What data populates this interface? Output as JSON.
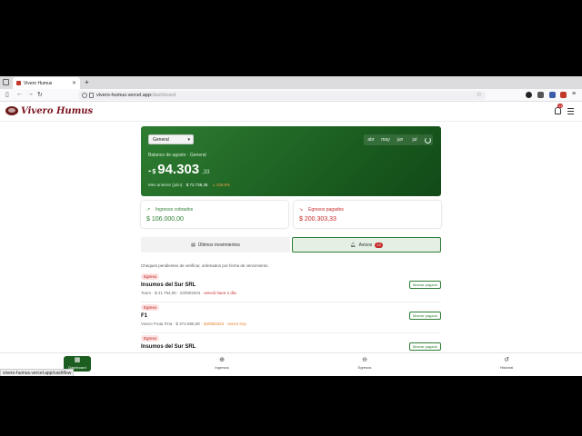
{
  "browser": {
    "tab_title": "Vivero Humus",
    "url_host": "vivero-humus.vercel.app",
    "url_path": "/dashboard",
    "status_url": "vivero-humus.vercel.app/cashflow"
  },
  "header": {
    "brand": "Vivero Humus",
    "notif_count": "13"
  },
  "balance": {
    "select_value": "General",
    "months": [
      "abr",
      "may",
      "jun",
      "jul"
    ],
    "label": "Balance de agosto · General",
    "sign": "-",
    "currency": "$",
    "value": "94.303",
    "decimals": ",33",
    "prev_label": "Mes anterior (julio):",
    "prev_value": "$ 72.738,36",
    "prev_pct": "↘ 229,6%"
  },
  "cards": {
    "income_label": "Ingresos cobrados",
    "income_value": "$ 106.000,00",
    "expense_label": "Egresos pagados",
    "expense_value": "$ 200.303,33"
  },
  "subtabs": {
    "movements": "Últimos movimientos",
    "alerts": "Avisos",
    "alerts_count": "13"
  },
  "hint": "Cheques pendientes de verificar, ordenados por fecha de vencimiento",
  "rows": [
    {
      "tag": "Egreso",
      "title": "Insumos del Sur SRL",
      "sub_a": "Tours · $ 41.794,00 · 23/08/2024 · ",
      "sub_b": "venció hace 1 día",
      "button": "Marcar pagado"
    },
    {
      "tag": "Egreso",
      "title": "F1",
      "sub_a": "Vivero Fruta Fina · $ 374.686,08 · ",
      "sub_b": "26/08/2024 · vence hoy",
      "button": "Marcar pagado"
    },
    {
      "tag": "Egreso",
      "title": "Insumos del Sur SRL",
      "sub_a": "",
      "sub_b": "",
      "button": "Marcar pagado"
    }
  ],
  "bottom_nav": {
    "dashboard": "Dashboard",
    "ingresos": "Ingresos",
    "egresos": "Egresos",
    "historial": "Historial"
  },
  "colors": {
    "brand": "#7a1420",
    "primary": "#2e7d32",
    "danger": "#c62828"
  }
}
